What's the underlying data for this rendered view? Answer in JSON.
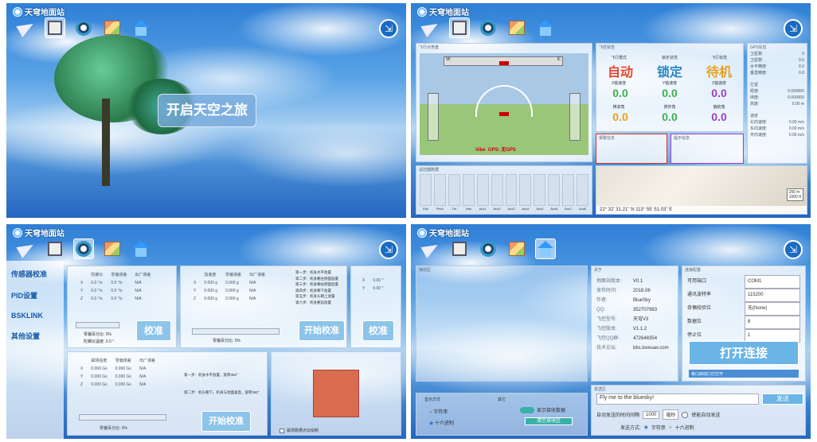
{
  "app": {
    "title": "天穹地面站"
  },
  "p1": {
    "start_label": "开启天空之旅"
  },
  "p2": {
    "hud_title": "飞行仪表盘",
    "status_title": "飞控状态",
    "gps_title": "GPS信息",
    "mode_label": "飞行模式",
    "mode_value": "自动",
    "lock_label": "锁定状态",
    "lock_value": "锁定",
    "state_label": "飞行状态",
    "state_value": "待机",
    "vx_label": "X轴速度",
    "vx": "0.0",
    "vy_label": "Y轴速度",
    "vy": "0.0",
    "vz_label": "Z轴速度",
    "vz": "0.0",
    "roll_label": "横滚角",
    "roll": "0.0",
    "pitch_label": "俯仰角",
    "pitch": "0.0",
    "yaw_label": "偏航角",
    "yaw": "0.0",
    "warn_title": "报警信息",
    "info_title": "提示信息",
    "channel_title": "遥控器数据",
    "channels": [
      "Roll",
      "Pitch",
      "Thr",
      "Yaw",
      "Aux1",
      "Aux2",
      "Aux3",
      "Aux4",
      "Aux5",
      "Aux6",
      "Aux7",
      "Aux8"
    ],
    "gps_rows": [
      {
        "k": "卫星数:",
        "v": "0"
      },
      {
        "k": "卫星数:",
        "v": "0.0"
      },
      {
        "k": "水平精度:",
        "v": "0.0"
      },
      {
        "k": "垂直精度:",
        "v": "0.0"
      }
    ],
    "pos_title": "位置",
    "pos_rows": [
      {
        "k": "经度:",
        "v": "0.000000"
      },
      {
        "k": "纬度:",
        "v": "0.000000"
      },
      {
        "k": "高度:",
        "v": "0.00 m"
      }
    ],
    "vel_title": "速度",
    "vel_rows": [
      {
        "k": "北向速度:",
        "v": "0.00 m/s"
      },
      {
        "k": "东向速度:",
        "v": "0.00 m/s"
      },
      {
        "k": "天向速度:",
        "v": "0.00 m/s"
      }
    ],
    "compass_w": "W",
    "compass_e": "E",
    "vibe": "Vibe",
    "gps_status": "GPS: 无GPS",
    "map_coords": "22° 32' 31.21'' N 113° 55' 51.03'' E",
    "scale1": "250 m",
    "scale2": "1000 ft"
  },
  "p3": {
    "side": [
      "传感器校准",
      "PID设置",
      "BSKLINK",
      "其他设置"
    ],
    "gyro_cols": [
      "",
      "陀螺仪",
      "零偏误差",
      "出厂误差"
    ],
    "gyro_rows": [
      [
        "X",
        "0.0 °/s",
        "0.0 °/s",
        "N/A"
      ],
      [
        "Y",
        "0.0 °/s",
        "0.0 °/s",
        "N/A"
      ],
      [
        "Z",
        "0.0 °/s",
        "0.0 °/s",
        "N/A"
      ]
    ],
    "gyro_prog": "零偏百分比:  0%",
    "gyro_temp": "陀螺仪温度:  0.0 °",
    "acc_cols": [
      "",
      "加速度",
      "零偏误差",
      "出厂误差"
    ],
    "acc_rows": [
      [
        "X",
        "0.000 g",
        "0.000 g",
        "N/A"
      ],
      [
        "Y",
        "0.000 g",
        "0.000 g",
        "N/A"
      ],
      [
        "Z",
        "0.000 g",
        "0.000 g",
        "N/A"
      ]
    ],
    "acc_prog": "零偏百分比:  0%",
    "steps": [
      "第一步：机身水平放置",
      "第二步：机身朝左侧面放置",
      "第三步：机身朝右侧面放置",
      "第四步：机身朝下放置",
      "第五步：机身头朝上放置",
      "第六步：机身朝前放置"
    ],
    "lvl_rows": [
      [
        "X",
        "0.00 °"
      ],
      [
        "Y",
        "0.00 °"
      ]
    ],
    "mag_cols": [
      "",
      "磁场强度",
      "零偏误差",
      "出厂误差"
    ],
    "mag_rows": [
      [
        "X",
        "0.000 Gs",
        "0.000 Gs",
        "N/A"
      ],
      [
        "Y",
        "0.000 Gs",
        "0.000 Gs",
        "N/A"
      ],
      [
        "Z",
        "0.000 Gs",
        "0.000 Gs",
        "N/A"
      ]
    ],
    "mag_prog": "零偏百分比:  0%",
    "mag_steps": [
      "第一步：机身水平放置，旋转360°",
      "第二步：机头朝下，机身与地面垂直，旋转360°"
    ],
    "cal": "校准",
    "start_cal": "开始校准",
    "level_cal": "校准",
    "mag_start": "开始校准",
    "plot_clear": "磁场数据点云绘制"
  },
  "p4": {
    "recv_title": "接收区",
    "about_title": "关于",
    "serial_title": "连接配置",
    "about": [
      {
        "k": "地面站版本:",
        "v": "V0.1"
      },
      {
        "k": "发布时间:",
        "v": "2018.06"
      },
      {
        "k": "作者:",
        "v": "BlueSky"
      },
      {
        "k": "QQ:",
        "v": "352707983"
      },
      {
        "k": "飞控型号:",
        "v": "天穹V3"
      },
      {
        "k": "飞控版本:",
        "v": "V1.1.2"
      },
      {
        "k": "飞控QQ群:",
        "v": "472648354"
      },
      {
        "k": "技术论坛:",
        "v": "bbs.loveuav.com"
      }
    ],
    "serial": [
      {
        "k": "可用端口",
        "v": "COM1"
      },
      {
        "k": "通讯波特率",
        "v": "115200"
      },
      {
        "k": "奇偶校验位",
        "v": "无(None)"
      },
      {
        "k": "数据位",
        "v": "8"
      },
      {
        "k": "停止位",
        "v": "1"
      }
    ],
    "connect": "打开连接",
    "status": "串口启动口已打开",
    "send_title": "发送区",
    "send_text": "Fly me to the bluesky!",
    "send_btn": "发送",
    "display_mode": "显示方式",
    "mode_char": "字符串",
    "mode_hex": "十六进制",
    "clear_label": "其它",
    "show_recv": "显示接收数据",
    "clear_recv": "清空接收区",
    "auto_send_label": "自动发送的时间间隔",
    "auto_send_val": "1000",
    "unit": "毫秒",
    "auto_send_toggle": "使能自动发送",
    "send_mode": "发送方式:",
    "send_char": "字符串",
    "send_hex": "十六进制"
  }
}
